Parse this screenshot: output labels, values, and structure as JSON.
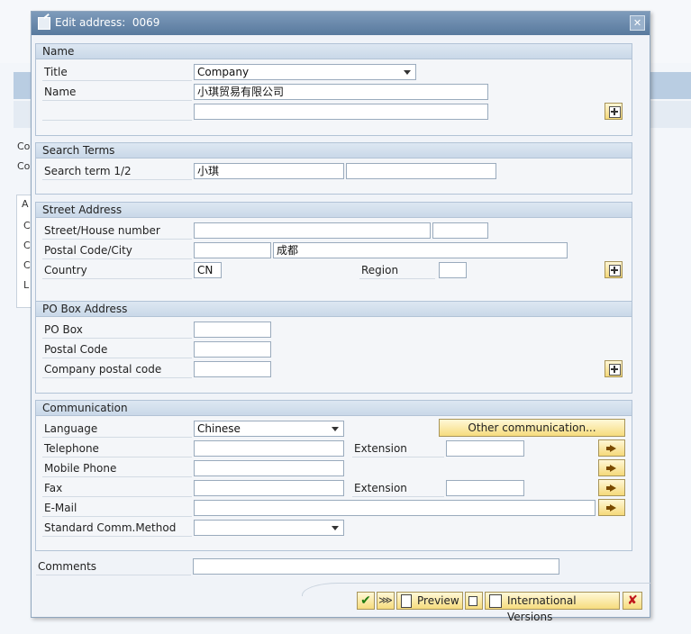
{
  "background": {
    "labels": [
      "Co",
      "Co",
      "A",
      "C",
      "C",
      "C",
      "L"
    ]
  },
  "dialog": {
    "title": "Edit address:  0069",
    "close_label": "✕",
    "name_group": {
      "header": "Name",
      "title_label": "Title",
      "title_value": "Company",
      "name_label": "Name",
      "name_value": "小琪贸易有限公司",
      "name2_value": ""
    },
    "search_group": {
      "header": "Search Terms",
      "term_label": "Search term 1/2",
      "term1_value": "小琪",
      "term2_value": ""
    },
    "street_group": {
      "header": "Street Address",
      "street_label": "Street/House number",
      "street_value": "",
      "house_value": "",
      "postal_label": "Postal Code/City",
      "postal_value": "",
      "city_value": "成都",
      "country_label": "Country",
      "country_value": "CN",
      "region_label": "Region",
      "region_value": ""
    },
    "pobox_group": {
      "header": "PO Box Address",
      "pobox_label": "PO Box",
      "pobox_value": "",
      "postal_label": "Postal Code",
      "postal_value": "",
      "company_postal_label": "Company postal code",
      "company_postal_value": ""
    },
    "comm_group": {
      "header": "Communication",
      "language_label": "Language",
      "language_value": "Chinese",
      "other_comm_label": "Other communication...",
      "telephone_label": "Telephone",
      "telephone_value": "",
      "extension_label": "Extension",
      "extension_value": "",
      "mobile_label": "Mobile Phone",
      "mobile_value": "",
      "fax_label": "Fax",
      "fax_value": "",
      "fax_extension_label": "Extension",
      "fax_extension_value": "",
      "email_label": "E-Mail",
      "email_value": "",
      "std_comm_label": "Standard Comm.Method",
      "std_comm_value": ""
    },
    "comments_label": "Comments",
    "comments_value": "",
    "footer": {
      "confirm_icon": "✔",
      "expand_icon": "⋙",
      "preview_label": "Preview",
      "intl_versions_label": "International Versions",
      "cancel_icon": "✘"
    }
  }
}
